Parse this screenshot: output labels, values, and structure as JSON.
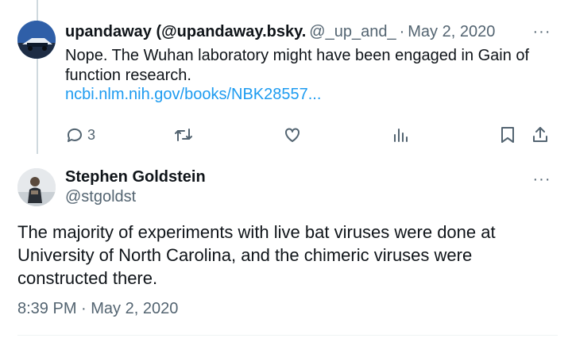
{
  "reply": {
    "display_name": "upandaway (@upandaway.bsky.",
    "handle": "@_up_and_",
    "separator": "·",
    "date": "May 2, 2020",
    "text": "Nope. The Wuhan laboratory might have been engaged in Gain of function research.",
    "link": "ncbi.nlm.nih.gov/books/NBK28557...",
    "more_label": "···",
    "actions": {
      "reply_count": "3",
      "retweet_count": "",
      "like_count": ""
    }
  },
  "main_tweet": {
    "display_name": "Stephen Goldstein",
    "handle": "@stgoldst",
    "more_label": "···",
    "text": "The majority of experiments with live bat viruses were done at University of North Carolina, and the chimeric viruses were constructed there.",
    "timestamp": "8:39 PM · May 2, 2020"
  },
  "colors": {
    "text": "#0f1419",
    "secondary": "#536471",
    "link": "#1d9bf0",
    "thread_line": "#cfd9de"
  },
  "icons": [
    "reply-icon",
    "retweet-icon",
    "like-icon",
    "views-icon",
    "bookmark-icon",
    "share-icon",
    "more-icon"
  ]
}
